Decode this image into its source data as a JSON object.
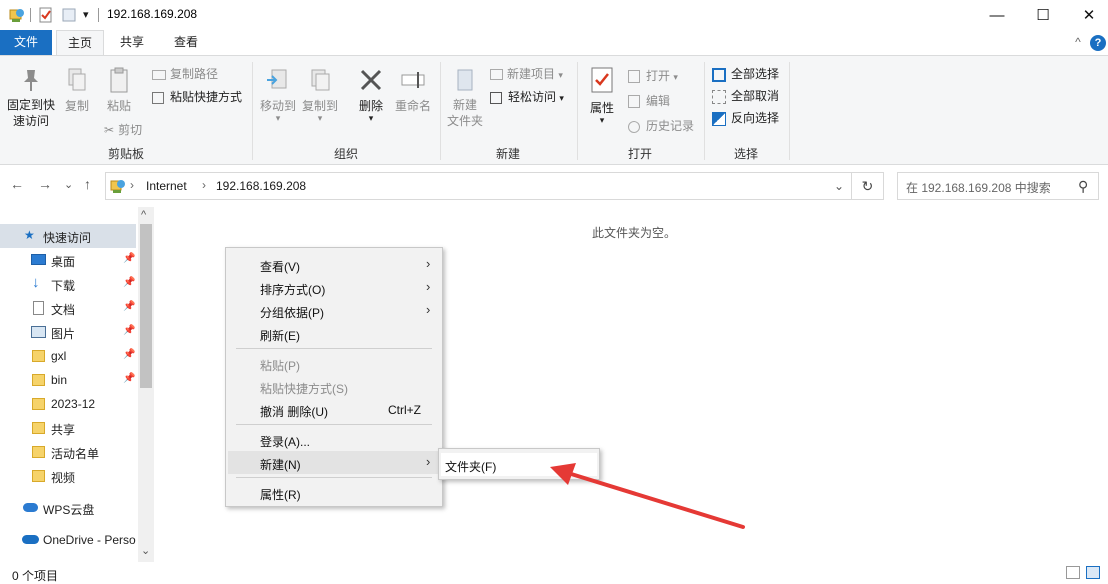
{
  "window": {
    "title": "192.168.169.208",
    "qa_dropdown": "▾",
    "minimize": "—",
    "maximize": "☐",
    "close": "✕"
  },
  "tabs": {
    "file": "文件",
    "home": "主页",
    "share": "共享",
    "view": "查看",
    "collapse": "^",
    "help": "?"
  },
  "ribbon": {
    "pin": "固定到快速访问",
    "pin_l1": "固定到快",
    "pin_l2": "速访问",
    "copy": "复制",
    "paste": "粘贴",
    "copy_path": "复制路径",
    "paste_shortcut": "粘贴快捷方式",
    "cut": "剪切",
    "group_clipboard": "剪贴板",
    "move_to": "移动到",
    "copy_to": "复制到",
    "delete": "删除",
    "rename": "重命名",
    "group_organize": "组织",
    "new_folder_l1": "新建",
    "new_folder_l2": "文件夹",
    "new_item": "新建项目",
    "easy_access": "轻松访问",
    "group_new": "新建",
    "properties": "属性",
    "open": "打开",
    "edit": "编辑",
    "history": "历史记录",
    "group_open": "打开",
    "select_all": "全部选择",
    "select_none": "全部取消",
    "invert_selection": "反向选择",
    "group_select": "选择",
    "dropdown_arrow": "▾"
  },
  "address": {
    "back": "←",
    "forward": "→",
    "recent": "⌄",
    "up": "↑",
    "crumb_sep": "›",
    "crumb_internet": "Internet",
    "crumb_host": "192.168.169.208",
    "dropdown": "⌄",
    "refresh": "↻",
    "search_placeholder": "在 192.168.169.208 中搜索",
    "search_icon": "⚲"
  },
  "navpane": {
    "scroll_up": "^",
    "scroll_down": "⌄",
    "pin_glyph": "📌",
    "quick_access": "快速访问",
    "items": [
      {
        "label": "桌面",
        "pinned": true
      },
      {
        "label": "下载",
        "pinned": true
      },
      {
        "label": "文档",
        "pinned": true
      },
      {
        "label": "图片",
        "pinned": true
      },
      {
        "label": "gxl",
        "pinned": true
      },
      {
        "label": "bin",
        "pinned": true
      },
      {
        "label": "2023-12",
        "pinned": false
      },
      {
        "label": "共享",
        "pinned": false
      },
      {
        "label": "活动名单",
        "pinned": false
      },
      {
        "label": "视频",
        "pinned": false
      }
    ],
    "wps": "WPS云盘",
    "onedrive": "OneDrive - Perso"
  },
  "content": {
    "empty_text": "此文件夹为空。"
  },
  "context_menu": {
    "view": "查看(V)",
    "sort": "排序方式(O)",
    "group": "分组依据(P)",
    "refresh": "刷新(E)",
    "paste": "粘贴(P)",
    "paste_shortcut": "粘贴快捷方式(S)",
    "undo_delete": "撤消 删除(U)",
    "undo_shortcut": "Ctrl+Z",
    "login": "登录(A)...",
    "new": "新建(N)",
    "properties": "属性(R)",
    "arrow": "›"
  },
  "submenu": {
    "folder": "文件夹(F)"
  },
  "status": {
    "item_count": "0 个项目"
  },
  "colors": {
    "accent": "#1a6fc2",
    "annotation_arrow": "#e53935"
  }
}
